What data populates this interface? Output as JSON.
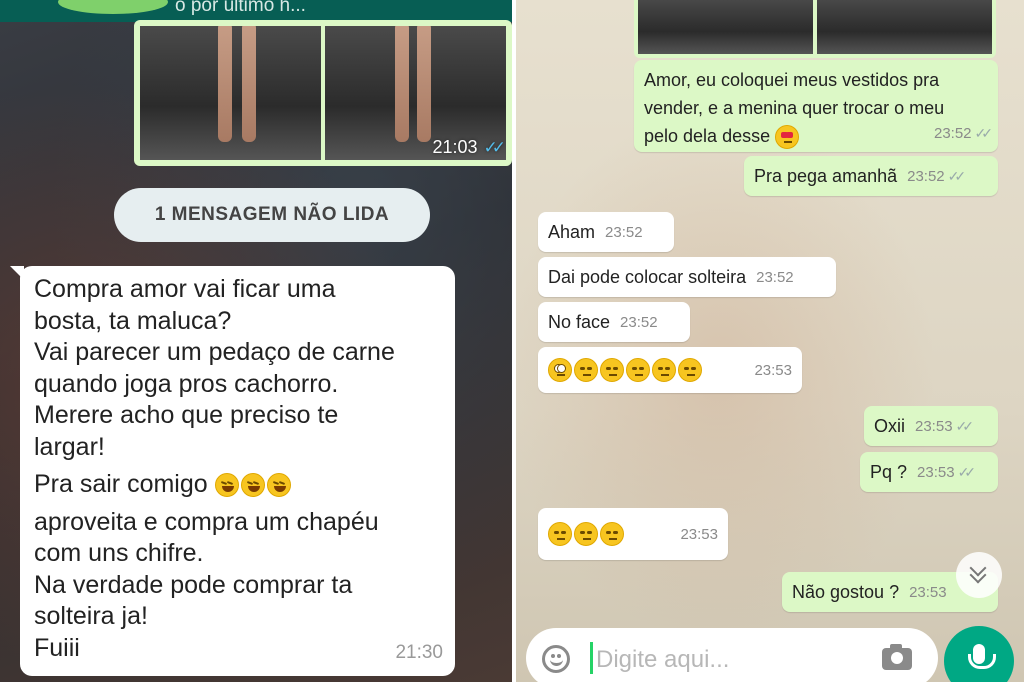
{
  "left_panel": {
    "header_partial": "o por último h...",
    "photo_time": "21:03",
    "unread_banner": "1 MENSAGEM NÃO LIDA",
    "message": {
      "lines1": [
        "Compra amor vai ficar uma",
        "bosta,  ta maluca?",
        "Vai parecer um pedaço de carne",
        "quando joga pros cachorro.",
        "Merere acho que preciso te",
        "largar!"
      ],
      "line_sair": "Pra sair comigo",
      "lines2": [
        "aproveita e compra um chapéu",
        "com uns chifre.",
        "Na verdade pode comprar ta",
        "solteira ja!",
        "Fuiii"
      ],
      "time": "21:30"
    }
  },
  "right_panel": {
    "messages": [
      {
        "dir": "out",
        "text_lines": [
          "Amor, eu coloquei meus vestidos pra",
          "vender, e a menina quer trocar o meu",
          "pelo dela desse"
        ],
        "time": "23:52"
      },
      {
        "dir": "out",
        "text": "Pra pega amanhã",
        "time": "23:52"
      },
      {
        "dir": "in",
        "text": "Aham",
        "time": "23:52"
      },
      {
        "dir": "in",
        "text": "Dai pode colocar solteira",
        "time": "23:52"
      },
      {
        "dir": "in",
        "text": "No face",
        "time": "23:52"
      },
      {
        "dir": "in",
        "text": "",
        "time": "23:53"
      },
      {
        "dir": "out",
        "text": "Oxii",
        "time": "23:53"
      },
      {
        "dir": "out",
        "text": "Pq ?",
        "time": "23:53"
      },
      {
        "dir": "in",
        "text": "",
        "time": "23:53"
      },
      {
        "dir": "out",
        "text": "Não gostou ?",
        "time": "23:53"
      }
    ],
    "input": {
      "placeholder": "Digite aqui..."
    }
  },
  "icons": [
    "read-receipt-icon",
    "emoji-icon",
    "camera-icon",
    "mic-icon",
    "scroll-down-icon"
  ],
  "colors": {
    "outgoing": "#dcf8c6",
    "incoming": "#ffffff",
    "header": "#075e54",
    "accent": "#00a884"
  }
}
